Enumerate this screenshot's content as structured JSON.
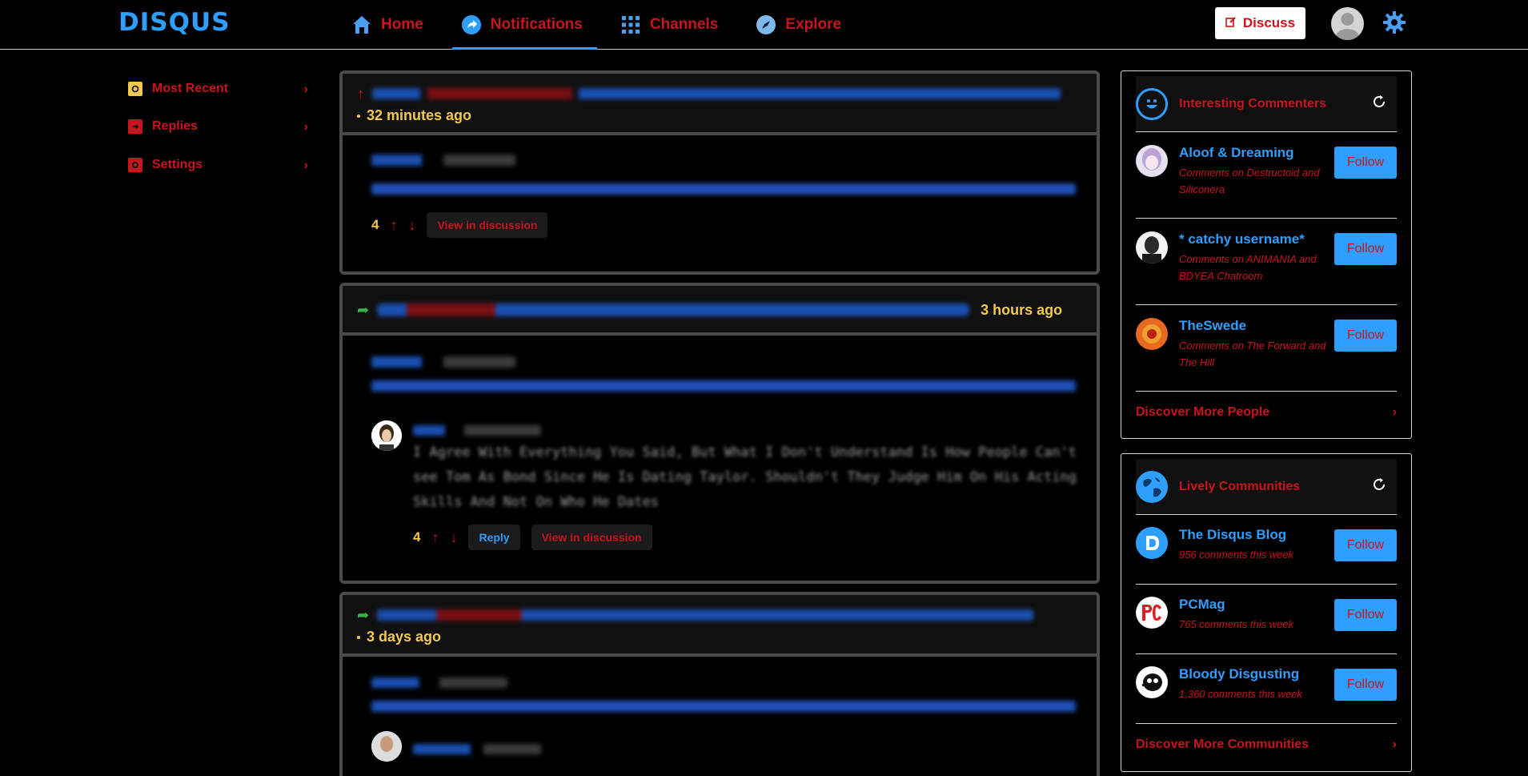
{
  "brand": {
    "logo": "DISQUS"
  },
  "nav": {
    "items": [
      {
        "label": "Home",
        "icon": "home-icon"
      },
      {
        "label": "Notifications",
        "icon": "notifications-icon"
      },
      {
        "label": "Channels",
        "icon": "grid-icon"
      },
      {
        "label": "Explore",
        "icon": "compass-icon"
      }
    ],
    "active": "Notifications",
    "discuss_label": "Discuss"
  },
  "sidebar": {
    "items": [
      {
        "label": "Most Recent",
        "icon": "most-recent-icon",
        "color": "#f2c94c"
      },
      {
        "label": "Replies",
        "icon": "replies-icon",
        "color": "#c8141c"
      },
      {
        "label": "Settings",
        "icon": "settings-icon",
        "color": "#c8141c"
      }
    ]
  },
  "feed": [
    {
      "time": "32 minutes ago",
      "body_score": "4",
      "view_label": "View in discussion"
    },
    {
      "time": "3 hours ago",
      "reply_text": "I Agree With Everything You Said, But What I Don't Understand Is How People Can't see Tom As Bond Since He Is Dating Taylor. Shouldn't They Judge Him On His Acting Skills And Not On Who He Dates",
      "score": "4",
      "reply_label": "Reply",
      "view_label": "View in discussion"
    },
    {
      "time": "3 days ago"
    }
  ],
  "commenters": {
    "title": "Interesting Commenters",
    "people": [
      {
        "name": "Aloof & Dreaming",
        "desc": "Comments on Destructoid and Siliconera",
        "follow": "Follow"
      },
      {
        "name": "* catchy username*",
        "desc": "Comments on ANIMANIA and BDYEA Chatroom",
        "follow": "Follow"
      },
      {
        "name": "TheSwede",
        "desc": "Comments on The Forward and The Hill",
        "follow": "Follow"
      }
    ],
    "discover": "Discover More People"
  },
  "communities": {
    "title": "Lively Communities",
    "items": [
      {
        "name": "The Disqus Blog",
        "desc": "956 comments this week",
        "follow": "Follow"
      },
      {
        "name": "PCMag",
        "desc": "765 comments this week",
        "follow": "Follow"
      },
      {
        "name": "Bloody Disgusting",
        "desc": "1,360 comments this week",
        "follow": "Follow"
      }
    ],
    "discover": "Discover More Communities"
  },
  "colors": {
    "accent": "#2e9fff",
    "link_red": "#c8141c",
    "highlight": "#f2c94c",
    "background": "#000000"
  }
}
